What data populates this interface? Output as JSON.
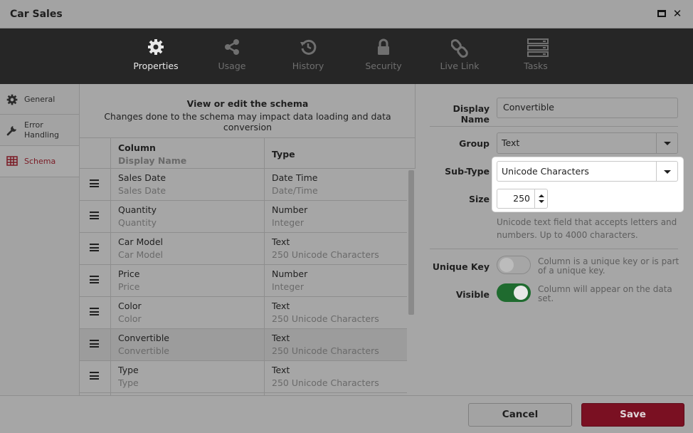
{
  "window": {
    "title": "Car Sales"
  },
  "toolbar": {
    "tabs": [
      {
        "label": "Properties",
        "icon": "gear-icon",
        "active": true
      },
      {
        "label": "Usage",
        "icon": "share-icon",
        "active": false
      },
      {
        "label": "History",
        "icon": "history-icon",
        "active": false
      },
      {
        "label": "Security",
        "icon": "lock-icon",
        "active": false
      },
      {
        "label": "Live Link",
        "icon": "link-icon",
        "active": false
      },
      {
        "label": "Tasks",
        "icon": "tasks-icon",
        "active": false
      }
    ]
  },
  "sidebar": {
    "items": [
      {
        "label": "General",
        "icon": "gear-icon"
      },
      {
        "label": "Error\nHandling",
        "icon": "wrench-icon"
      },
      {
        "label": "Schema",
        "icon": "table-icon",
        "active": true
      }
    ]
  },
  "schema": {
    "heading": "View or edit the schema",
    "subheading": "Changes done to the schema may impact data loading and data conversion",
    "columns": {
      "column": "Column",
      "display_name": "Display Name",
      "type": "Type"
    },
    "rows": [
      {
        "name": "Sales Date",
        "display": "Sales Date",
        "type": "Date Time",
        "subtype": "Date/Time"
      },
      {
        "name": "Quantity",
        "display": "Quantity",
        "type": "Number",
        "subtype": "Integer"
      },
      {
        "name": "Car Model",
        "display": "Car Model",
        "type": "Text",
        "subtype": "250 Unicode Characters"
      },
      {
        "name": "Price",
        "display": "Price",
        "type": "Number",
        "subtype": "Integer"
      },
      {
        "name": "Color",
        "display": "Color",
        "type": "Text",
        "subtype": "250 Unicode Characters"
      },
      {
        "name": "Convertible",
        "display": "Convertible",
        "type": "Text",
        "subtype": "250 Unicode Characters",
        "selected": true
      },
      {
        "name": "Type",
        "display": "Type",
        "type": "Text",
        "subtype": "250 Unicode Characters"
      }
    ]
  },
  "properties": {
    "display_name_label": "Display Name",
    "display_name_value": "Convertible",
    "group_label": "Group",
    "group_value": "Text",
    "subtype_label": "Sub-Type",
    "subtype_value": "Unicode Characters",
    "size_label": "Size",
    "size_value": "250",
    "hint": "Unicode text field that accepts letters and numbers. Up to 4000 characters.",
    "unique_key_label": "Unique Key",
    "unique_key_note": "Column is a unique key or is part of a unique key.",
    "unique_key_on": false,
    "visible_label": "Visible",
    "visible_note": "Column will appear on the data set.",
    "visible_on": true
  },
  "footer": {
    "cancel_label": "Cancel",
    "save_label": "Save"
  },
  "colors": {
    "accent": "#7a1022",
    "toggle_on": "#1f6b2f",
    "toolbar_bg": "#262626"
  }
}
